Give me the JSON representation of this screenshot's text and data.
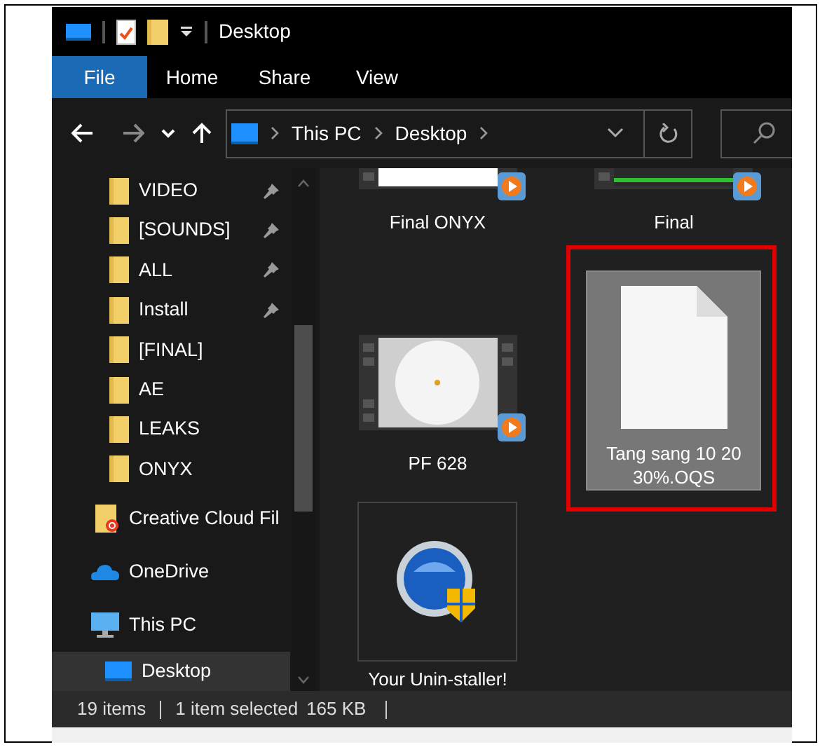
{
  "window": {
    "title": "Desktop"
  },
  "ribbon_tabs": [
    {
      "label": "File",
      "selected": true
    },
    {
      "label": "Home",
      "selected": false
    },
    {
      "label": "Share",
      "selected": false
    },
    {
      "label": "View",
      "selected": false
    }
  ],
  "address": {
    "breadcrumb": [
      "This PC",
      "Desktop"
    ]
  },
  "sidebar": {
    "items": [
      {
        "label": "VIDEO",
        "kind": "folder",
        "pinned": true,
        "selected": false
      },
      {
        "label": "[SOUNDS]",
        "kind": "folder",
        "pinned": true,
        "selected": false
      },
      {
        "label": "ALL",
        "kind": "folder",
        "pinned": true,
        "selected": false
      },
      {
        "label": "Install",
        "kind": "folder",
        "pinned": true,
        "selected": false
      },
      {
        "label": "[FINAL]",
        "kind": "folder",
        "pinned": false,
        "selected": false
      },
      {
        "label": "AE",
        "kind": "folder",
        "pinned": false,
        "selected": false
      },
      {
        "label": "LEAKS",
        "kind": "folder",
        "pinned": false,
        "selected": false
      },
      {
        "label": "ONYX",
        "kind": "folder",
        "pinned": false,
        "selected": false
      },
      {
        "label": "Creative Cloud Fil",
        "kind": "cloud_files",
        "pinned": false,
        "selected": false
      },
      {
        "label": "OneDrive",
        "kind": "onedrive",
        "pinned": false,
        "selected": false
      },
      {
        "label": "This PC",
        "kind": "pc",
        "pinned": false,
        "selected": false
      },
      {
        "label": "Desktop",
        "kind": "desktop",
        "pinned": false,
        "selected": true
      }
    ]
  },
  "files": [
    {
      "name": "Final ONYX",
      "kind": "video",
      "selected": false,
      "outlined": false
    },
    {
      "name": "Final",
      "kind": "video",
      "selected": false,
      "outlined": false
    },
    {
      "name": "PF 628",
      "kind": "video",
      "selected": false,
      "outlined": false
    },
    {
      "name": "Tang sang 10 20 30%.OQS",
      "kind": "document",
      "selected": true,
      "outlined": true
    },
    {
      "name": "Your Unin-staller!",
      "kind": "app",
      "selected": false,
      "outlined": false
    }
  ],
  "status_bar": {
    "item_count": "19 items",
    "selection": "1 item selected",
    "size": "165 KB"
  }
}
